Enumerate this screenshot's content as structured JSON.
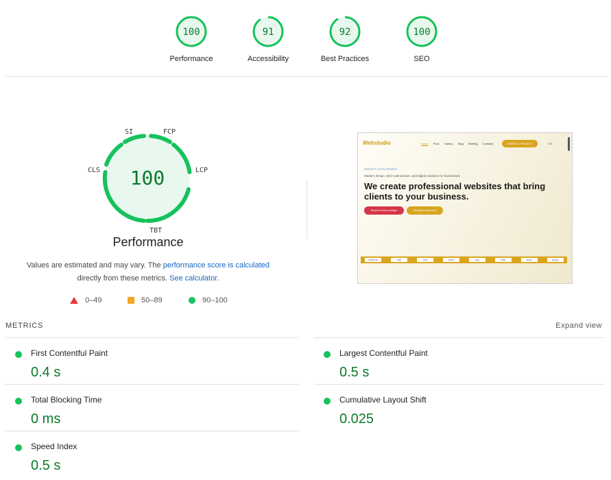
{
  "scores": [
    {
      "value": "100",
      "label": "Performance",
      "fraction": 1.0
    },
    {
      "value": "91",
      "label": "Accessibility",
      "fraction": 0.91
    },
    {
      "value": "92",
      "label": "Best Practices",
      "fraction": 0.92
    },
    {
      "value": "100",
      "label": "SEO",
      "fraction": 1.0
    }
  ],
  "performance": {
    "score": "100",
    "title": "Performance",
    "segments": {
      "si": "SI",
      "fcp": "FCP",
      "lcp": "LCP",
      "tbt": "TBT",
      "cls": "CLS"
    },
    "note_text1": "Values are estimated and may vary. The ",
    "note_link1": "performance score is calculated",
    "note_text2": "directly from these metrics. ",
    "note_link2": "See calculator",
    "note_text3": "."
  },
  "legend": [
    {
      "shape": "triangle",
      "range": "0–49",
      "color": "#e53935"
    },
    {
      "shape": "square",
      "range": "50–89",
      "color": "#f5a623"
    },
    {
      "shape": "circle",
      "range": "90–100",
      "color": "#16c25c"
    }
  ],
  "thumbnail": {
    "logo": "Webstudio",
    "nav": [
      "Home",
      "Price",
      "Gallery",
      "Blog",
      "Briefing",
      "Contacts"
    ],
    "cta": "ORDER A PROJECT",
    "lang": "EN",
    "tag": "WEBSITE DEVELOPMENT",
    "subtitle": "Modern design, SEO optimization, and digital solutions for businesses.",
    "headline": "We create professional websites that bring clients to your business.",
    "button1": "Request a free prototype",
    "button2": "Calculate a site's price",
    "chips": [
      "JavaScript",
      "PHP",
      "CSS",
      "Python",
      "Java",
      "HTML",
      "React",
      "Django"
    ]
  },
  "metrics": {
    "title": "METRICS",
    "expand": "Expand view",
    "items": [
      {
        "name": "First Contentful Paint",
        "value": "0.4 s"
      },
      {
        "name": "Largest Contentful Paint",
        "value": "0.5 s"
      },
      {
        "name": "Total Blocking Time",
        "value": "0 ms"
      },
      {
        "name": "Cumulative Layout Shift",
        "value": "0.025"
      },
      {
        "name": "Speed Index",
        "value": "0.5 s"
      }
    ]
  },
  "colors": {
    "pass_green": "#16c25c",
    "pass_text": "#0a7a2b",
    "gauge_fill": "#e9f8ee",
    "link": "#1565c0"
  }
}
